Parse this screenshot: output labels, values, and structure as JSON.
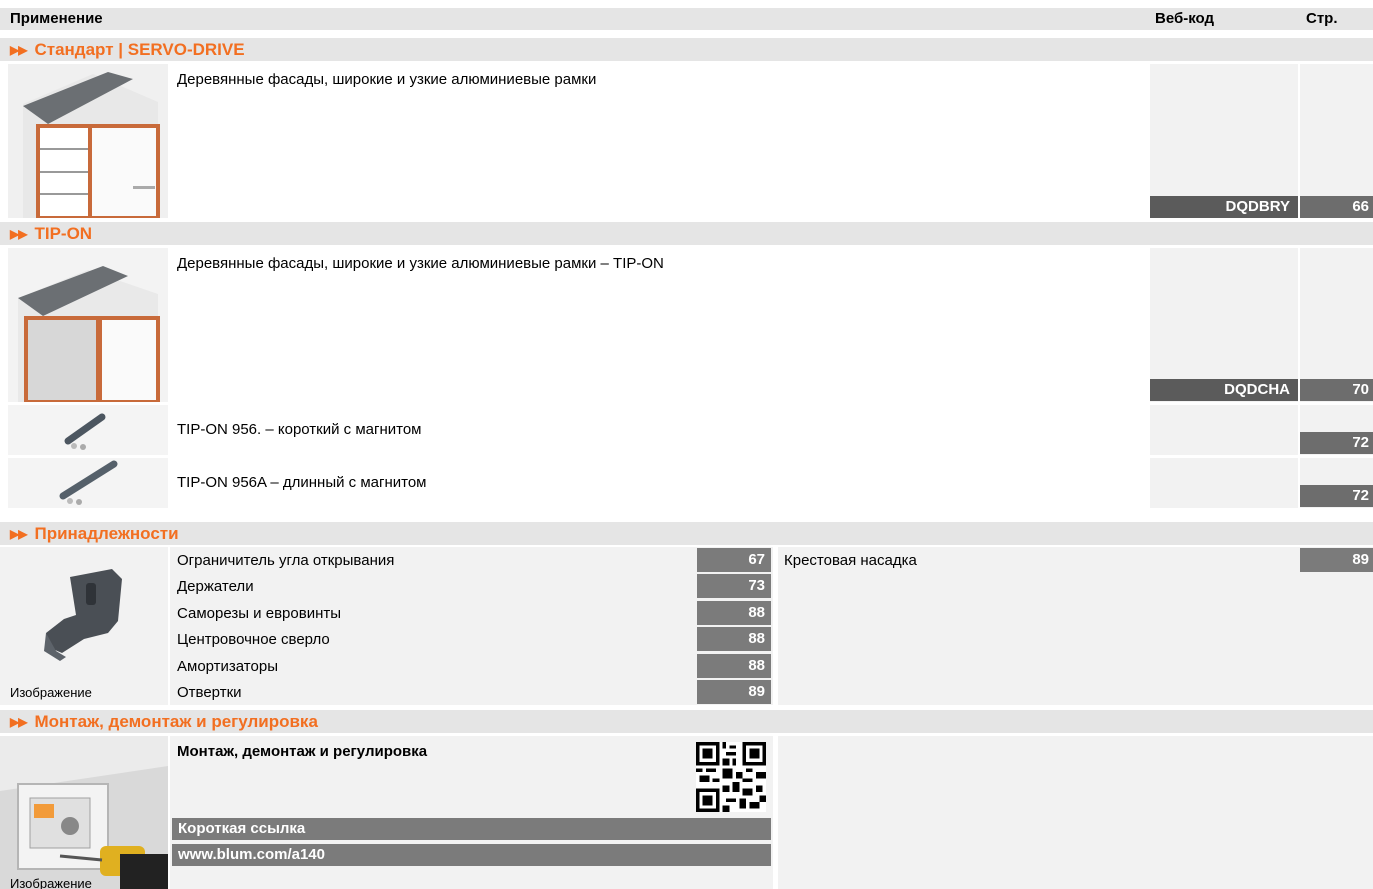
{
  "header": {
    "application": "Применение",
    "webcode": "Веб-код",
    "page": "Стр."
  },
  "sections": {
    "standard": {
      "title": "Стандарт | SERVO-DRIVE",
      "rows": [
        {
          "description": "Деревянные фасады, широкие и узкие алюминиевые рамки",
          "webcode": "DQDBRY",
          "page": "66"
        }
      ]
    },
    "tipon": {
      "title": "TIP-ON",
      "rows": [
        {
          "description": "Деревянные фасады, широкие и узкие алюминиевые рамки – TIP-ON",
          "webcode": "DQDCHA",
          "page": "70"
        },
        {
          "description": "TIP-ON 956. – короткий с магнитом",
          "page": "72"
        },
        {
          "description": "TIP-ON 956A – длинный с магнитом",
          "page": "72"
        }
      ]
    },
    "accessories": {
      "title": "Принадлежности",
      "image_label": "Изображение",
      "items": [
        {
          "label": "Ограничитель угла открывания",
          "page": "67"
        },
        {
          "label": "Держатели",
          "page": "73"
        },
        {
          "label": "Саморезы и евровинты",
          "page": "88"
        },
        {
          "label": "Центровочное сверло",
          "page": "88"
        },
        {
          "label": "Амортизаторы",
          "page": "88"
        },
        {
          "label": "Отвертки",
          "page": "89"
        }
      ],
      "right_items": [
        {
          "label": "Крестовая насадка",
          "page": "89"
        }
      ]
    },
    "assembly": {
      "title": "Монтаж, демонтаж и регулировка",
      "heading": "Монтаж, демонтаж и регулировка",
      "image_label": "Изображение",
      "short_link_label": "Короткая ссылка",
      "short_link": "www.blum.com/a140"
    }
  },
  "colors": {
    "accent": "#f26f21",
    "header_bg": "#e5e5e5",
    "dark_cell": "#6d6d6d",
    "page_cell": "#7b7b7b"
  },
  "icons": [
    "arrow-right-double-icon",
    "qr-code-icon"
  ]
}
